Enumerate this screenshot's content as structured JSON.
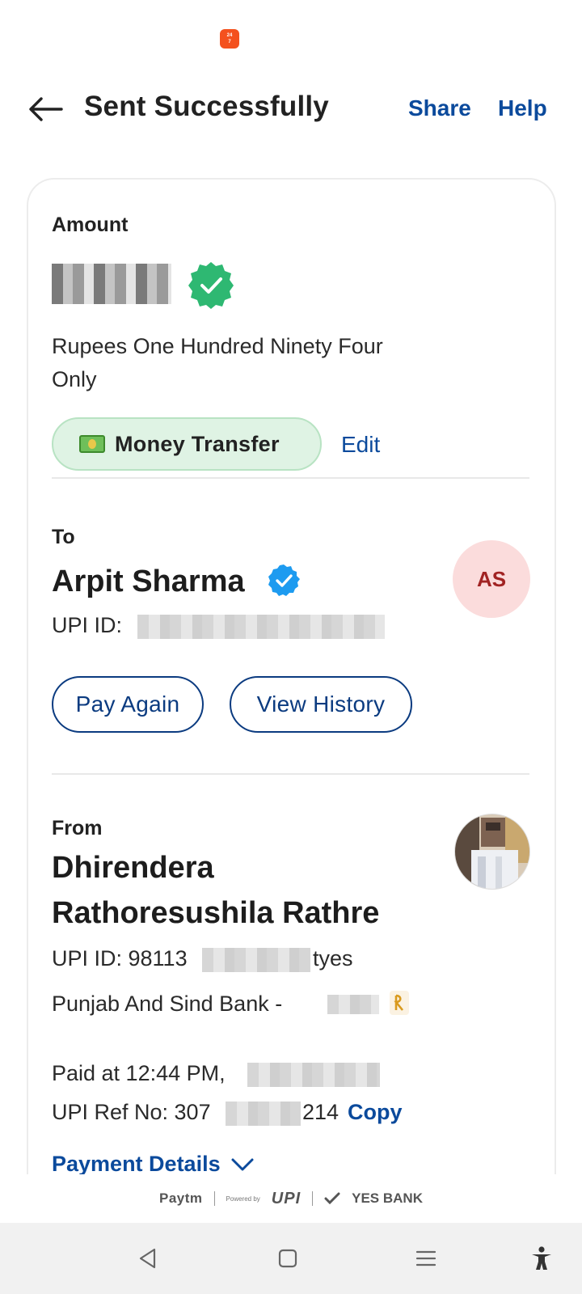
{
  "status_bar": {
    "notification_app": "Apollo 24/7"
  },
  "header": {
    "title": "Sent Successfully",
    "share_label": "Share",
    "help_label": "Help"
  },
  "amount": {
    "label": "Amount",
    "in_words": "Rupees One Hundred Ninety Four Only",
    "category": "Money Transfer",
    "edit_label": "Edit"
  },
  "to": {
    "label": "To",
    "name": "Arpit Sharma",
    "initials": "AS",
    "upi_label": "UPI ID:",
    "pay_again_label": "Pay Again",
    "view_history_label": "View History"
  },
  "from": {
    "label": "From",
    "name_line1": "Dhirendera",
    "name_line2": "Rathoresushila Rathre",
    "upi_prefix": "UPI ID: 98113",
    "upi_suffix": "tyes",
    "bank_prefix": "Punjab And Sind Bank - ",
    "paid_at_prefix": "Paid at 12:44 PM,",
    "ref_prefix": "UPI Ref No: 307",
    "ref_suffix": "214",
    "copy_label": "Copy"
  },
  "payment_details_label": "Payment Details",
  "footer": {
    "paytm": "Paytm",
    "powered_by": "Powered by",
    "upi": "UPI",
    "bank": "YES BANK"
  },
  "colors": {
    "link_blue": "#0b4a9c",
    "success_green": "#2eb872",
    "verified_blue": "#1d9bf0",
    "chip_bg": "#dff3e4",
    "avatar_bg": "#fbdcdc"
  }
}
